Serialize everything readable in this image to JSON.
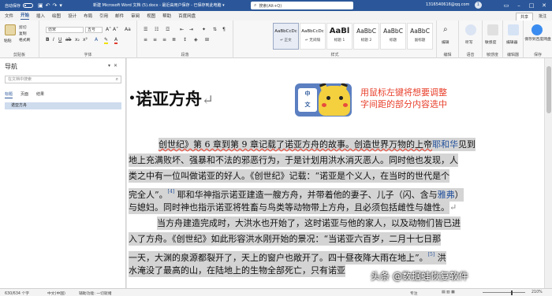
{
  "titlebar": {
    "autosave": "自动保存",
    "doc_title": "新建 Microsoft Word 文档 (5).docx  -  最近由用户保存 - 已保存到此电脑 ▾",
    "search_placeholder": "搜索(Alt+Q)",
    "account": "1316540616@qq.com",
    "avatar": "1"
  },
  "menu": {
    "tabs": [
      "文件",
      "开始",
      "插入",
      "绘图",
      "设计",
      "布局",
      "引用",
      "邮件",
      "审阅",
      "视图",
      "帮助",
      "百度网盘"
    ],
    "active_index": 1,
    "share": "共享",
    "comments": "批注"
  },
  "ribbon": {
    "clipboard": {
      "paste": "粘贴",
      "cut": "剪切",
      "copy": "复制",
      "format_painter": "格式刷",
      "label": "剪贴板"
    },
    "font": {
      "name": "仿宋",
      "size": "五号",
      "label": "字体"
    },
    "paragraph": {
      "label": "段落"
    },
    "styles": {
      "items": [
        {
          "sample": "AaBbCcDc",
          "name": "↵ 正文"
        },
        {
          "sample": "AaBbCcDc",
          "name": "↵ 无间隔"
        },
        {
          "sample": "AaBl",
          "name": "标题 1"
        },
        {
          "sample": "AaBbC",
          "name": "标题 2"
        },
        {
          "sample": "AaBbC",
          "name": "标题"
        },
        {
          "sample": "AaBbC",
          "name": "副标题"
        }
      ],
      "label": "样式"
    },
    "editing": {
      "label": "编辑",
      "button": "编辑"
    },
    "voice": {
      "label": "语音",
      "button": "听写"
    },
    "sensitivity": {
      "label": "敏感度",
      "button": "敏感度"
    },
    "editor": {
      "label": "编辑器",
      "button": "编辑器"
    },
    "baidu": {
      "label": "保存",
      "button": "保存到百度网盘"
    }
  },
  "nav": {
    "title": "导航",
    "search_placeholder": "在文档中搜索",
    "tabs": [
      "标题",
      "页面",
      "结果"
    ],
    "items": [
      "诺亚方舟"
    ]
  },
  "document": {
    "heading": "诺亚方舟",
    "annotation": [
      "用鼠标左键将想要调整",
      "字间距的部分内容选中"
    ],
    "lines": [
      [
        "创世纪》第 6 章到第 9 章记载了诺亚方舟的故事。创造世界万物的上帝",
        "耶和华",
        "见到"
      ],
      [
        "地上充满败坏、强暴和不法的邪恶行为，于是计划用洪水消灭恶人。同时他也发现，人"
      ],
      [
        "类之中有一位叫做诺亚的好人。《创世纪》记载：“诺亚是个义人，在当时的世代是个"
      ],
      [
        "完全人”。",
        "[4]",
        " 耶和华神指示诺亚建造一艘方舟，并带着他的妻子、儿子（闪、含与",
        "雅弗",
        "）"
      ],
      [
        "与媳妇。同时神也指示诺亚将牲畜与鸟类等动物带上方舟，且必须包括雌性与雄性。"
      ],
      [
        "当方舟建造完成时，大洪水也开始了，这时诺亚与他的家人，以及动物们皆已进"
      ],
      [
        "入了方舟。《创世纪》如此形容洪水刚开始的景况：“当诺亚六百岁，二月十七日那"
      ],
      [
        "一天，大渊的泉源都裂开了，天上的窗户也敞开了。四十昼夜降大雨在地上”。",
        "[5]",
        " 洪"
      ],
      [
        "水淹没了最高的山，在陆地上的生物全部死亡，只有诺亚"
      ]
    ]
  },
  "watermark": "头条 @数据蛙恢复软件",
  "status": {
    "page": "630/634 个字",
    "language": "中文(中国)",
    "accessibility": "辅助功能: 一切就绪",
    "focus": "专注",
    "zoom": "210%"
  }
}
